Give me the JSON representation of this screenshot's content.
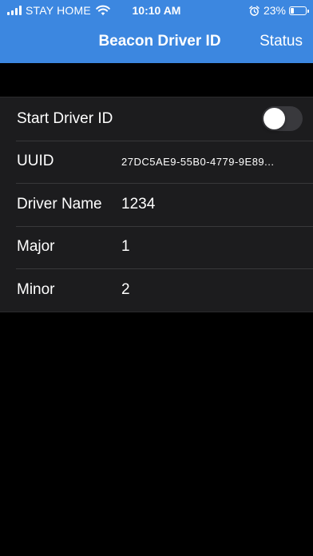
{
  "status_bar": {
    "carrier": "STAY HOME",
    "time": "10:10 AM",
    "battery_percent": "23%",
    "battery_level": 0.23,
    "icons": [
      "signal-icon",
      "wifi-icon",
      "alarm-icon",
      "battery-icon"
    ]
  },
  "nav": {
    "title": "Beacon Driver ID",
    "status_button": "Status"
  },
  "settings": {
    "start_driver_id": {
      "label": "Start Driver ID",
      "enabled": false
    },
    "uuid": {
      "label": "UUID",
      "value": "27DC5AE9-55B0-4779-9E89..."
    },
    "driver_name": {
      "label": "Driver Name",
      "value": "1234"
    },
    "major": {
      "label": "Major",
      "value": "1"
    },
    "minor": {
      "label": "Minor",
      "value": "2"
    }
  },
  "colors": {
    "header": "#3c87e0",
    "background": "#000000",
    "cell": "#1c1c1e",
    "toggle_off": "#39393d"
  }
}
